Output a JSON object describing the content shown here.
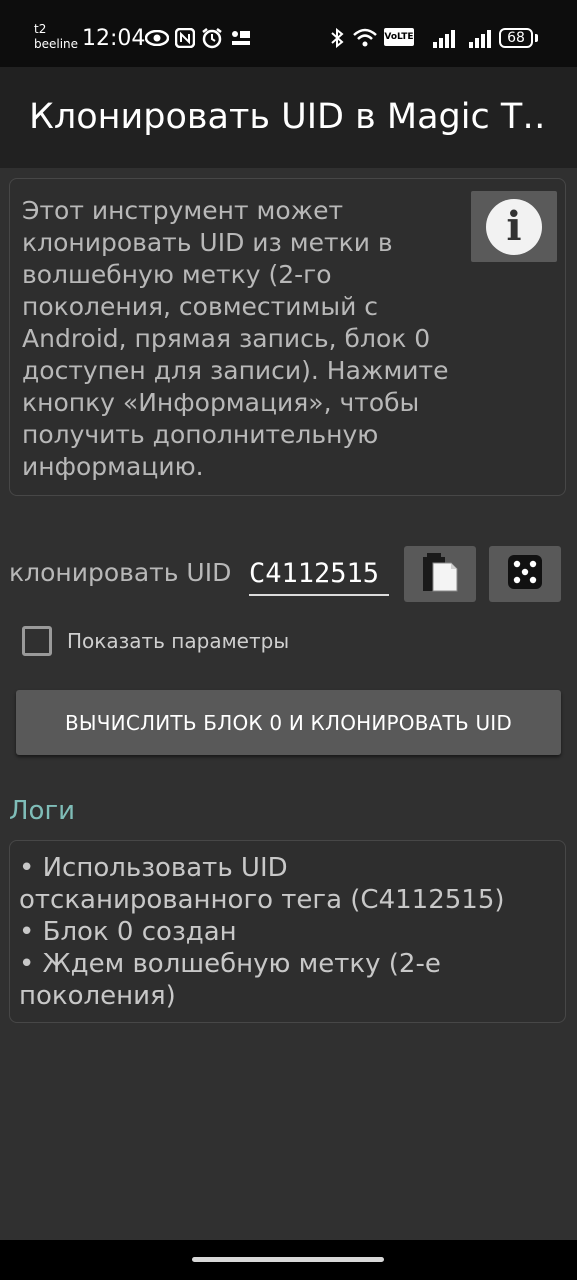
{
  "status_bar": {
    "carrier_line1": "t2",
    "carrier_line2": "beeline",
    "time": "12:04",
    "volte_label": "VoLTE",
    "battery": "68",
    "icons": [
      "eye-icon",
      "nfc-icon",
      "alarm-icon",
      "pmc-icon",
      "bluetooth-icon",
      "wifi-icon",
      "signal-icon",
      "signal-icon"
    ]
  },
  "toolbar": {
    "title": "Клонировать UID в Magic T…"
  },
  "description": {
    "text": "Этот инструмент может клонировать UID из метки в волшебную метку (2-го поколения, совместимый с Android, прямая запись, блок 0 доступен для записи). Нажмите кнопку «Информация», чтобы получить дополнительную информацию.",
    "info_icon": "info-icon"
  },
  "clone": {
    "label": "клонировать UID",
    "uid_value": "C4112515",
    "paste_icon": "paste-icon",
    "dice_icon": "dice-icon"
  },
  "options": {
    "show_params_label": "Показать параметры",
    "checked": false
  },
  "action": {
    "button_label": "ВЫЧИСЛИТЬ БЛОК 0 И КЛОНИРОВАТЬ UID"
  },
  "logs": {
    "heading": "Логи",
    "lines": [
      "• Использовать UID отсканированного тега (C4112515)",
      "• Блок 0 создан",
      "• Ждем волшебную метку (2-е поколения)"
    ]
  },
  "colors": {
    "background": "#303030",
    "toolbar": "#212121",
    "button": "#595959",
    "accent_heading": "#7fbdb8"
  }
}
